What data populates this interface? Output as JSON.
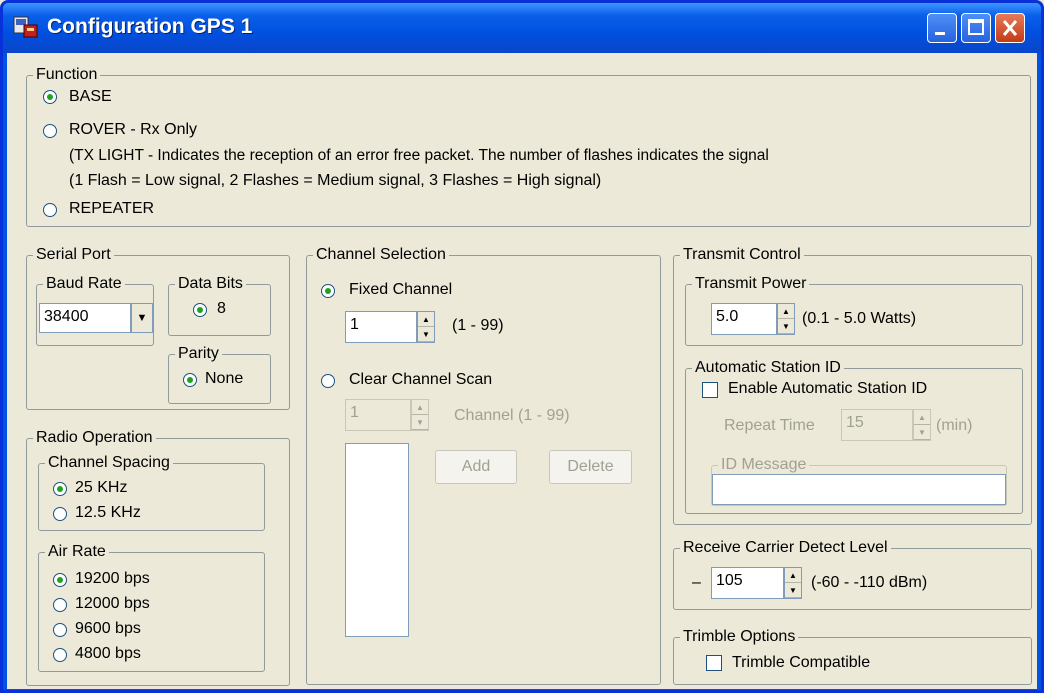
{
  "window": {
    "title": "Configuration GPS 1"
  },
  "function": {
    "label": "Function",
    "base": "BASE",
    "rover": "ROVER - Rx Only",
    "note1": "(TX LIGHT - Indicates the reception of an error free packet.  The number of flashes indicates the signal",
    "note2": "(1 Flash = Low signal, 2 Flashes = Medium signal, 3 Flashes = High signal)",
    "repeater": "REPEATER",
    "selected": "BASE"
  },
  "serial_port": {
    "label": "Serial Port",
    "baud_rate_label": "Baud Rate",
    "baud_rate_value": "38400",
    "data_bits_label": "Data Bits",
    "data_bits_value": "8",
    "parity_label": "Parity",
    "parity_value": "None"
  },
  "radio_operation": {
    "label": "Radio Operation",
    "channel_spacing_label": "Channel Spacing",
    "spacing_25": "25 KHz",
    "spacing_125": "12.5 KHz",
    "air_rate_label": "Air Rate",
    "rate_19200": "19200 bps",
    "rate_12000": "12000 bps",
    "rate_9600": "9600 bps",
    "rate_4800": "4800 bps"
  },
  "channel_selection": {
    "label": "Channel Selection",
    "fixed_channel": "Fixed Channel",
    "fixed_value": "1",
    "fixed_range": "(1 - 99)",
    "clear_scan": "Clear Channel Scan",
    "scan_value": "1",
    "scan_range": "Channel (1 - 99)",
    "add": "Add",
    "delete": "Delete"
  },
  "transmit_control": {
    "label": "Transmit Control",
    "power_label": "Transmit Power",
    "power_value": "5.0",
    "power_range": "(0.1 - 5.0 Watts)",
    "auto_id_label": "Automatic Station ID",
    "enable_auto_id": "Enable Automatic Station ID",
    "repeat_time_label": "Repeat Time",
    "repeat_time_value": "15",
    "repeat_time_unit": "(min)",
    "id_message_label": "ID Message",
    "id_message_value": ""
  },
  "receive_carrier": {
    "label": "Receive Carrier Detect Level",
    "sign": "–",
    "value": "105",
    "range": "(-60 - -110 dBm)"
  },
  "trimble": {
    "label": "Trimble Options",
    "compatible": "Trimble Compatible"
  },
  "colors": {
    "titlebar": "#0054e3",
    "client": "#ece9d8",
    "radio_dot": "#21a121"
  }
}
